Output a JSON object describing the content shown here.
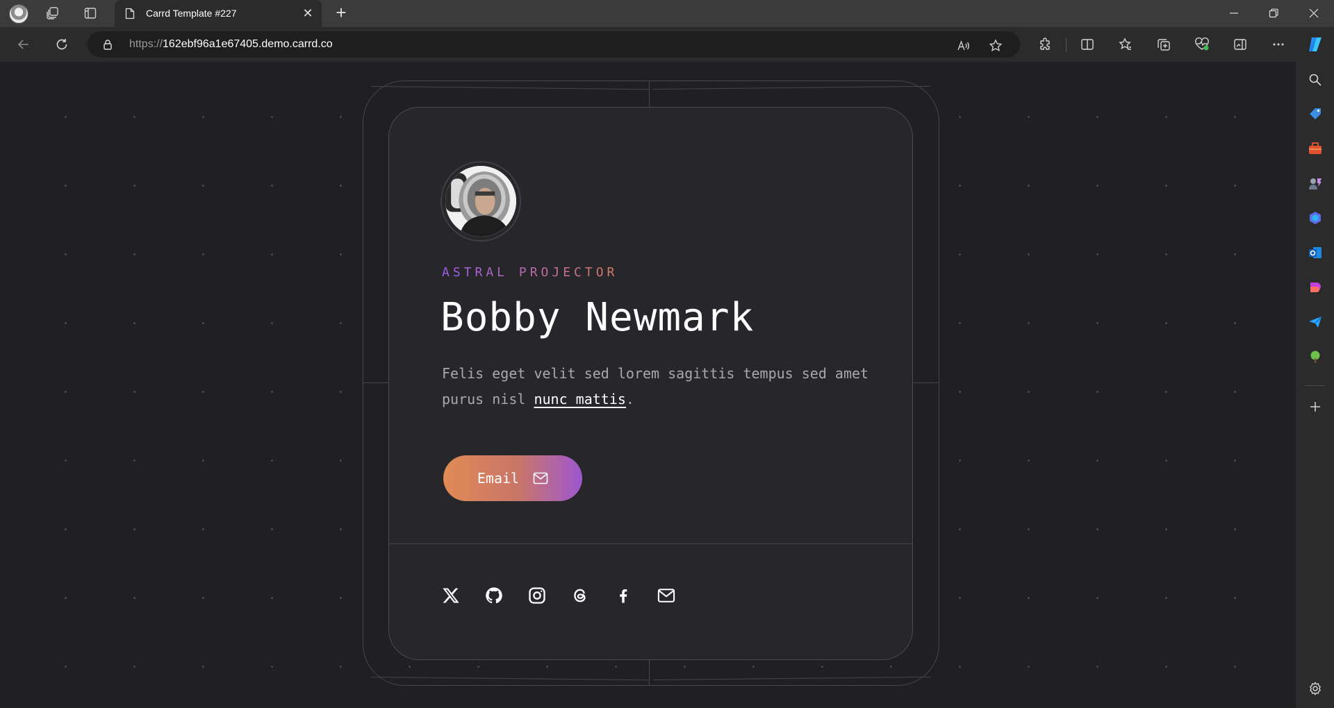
{
  "browser": {
    "tab_title": "Carrd Template #227",
    "url_prefix": "https://",
    "url_host": "162ebf96a1e67405.demo.carrd.co"
  },
  "profile": {
    "kicker": "ASTRAL PROJECTOR",
    "name": "Bobby Newmark",
    "description": "Felis eget velit sed lorem sagittis tempus sed amet purus nisl ",
    "description_link": "nunc mattis",
    "description_end": ".",
    "email_button_label": "Email"
  },
  "socials": [
    {
      "icon": "x-twitter-icon"
    },
    {
      "icon": "github-icon"
    },
    {
      "icon": "instagram-icon"
    },
    {
      "icon": "threads-icon"
    },
    {
      "icon": "facebook-icon"
    },
    {
      "icon": "mail-icon"
    }
  ],
  "colors": {
    "background": "#202024",
    "card": "#26262b",
    "gradient_start": "#e08a55",
    "gradient_end": "#9d57d0",
    "kicker_start": "#9b5cf0",
    "kicker_end": "#d97c63"
  }
}
